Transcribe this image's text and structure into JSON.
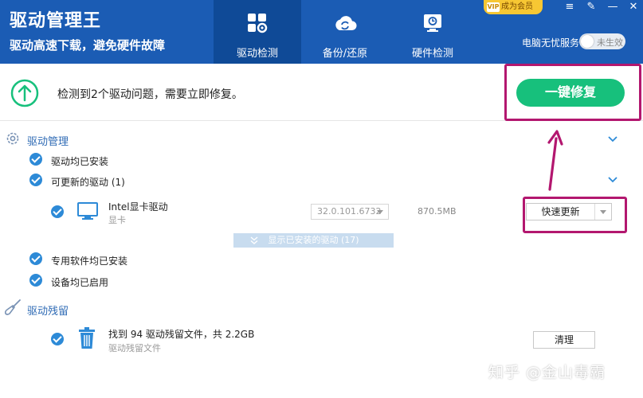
{
  "app": {
    "title": "驱动管理王",
    "subtitle": "驱动高速下载，避免硬件故障"
  },
  "nav": {
    "tabs": [
      {
        "label": "驱动检测",
        "active": true,
        "icon": "grid-gear-icon"
      },
      {
        "label": "备份/还原",
        "active": false,
        "icon": "cloud-sync-icon"
      },
      {
        "label": "硬件检测",
        "active": false,
        "icon": "monitor-check-icon"
      }
    ]
  },
  "vip": {
    "mark": "VIP",
    "label": "成为会员"
  },
  "window_controls": {
    "menu": "≡",
    "skin": "✎",
    "minimize": "—",
    "close": "✕"
  },
  "service": {
    "label": "电脑无忧服务",
    "state": "未生效"
  },
  "alert": {
    "message": "检测到2个驱动问题，需要立即修复。",
    "fix_button": "一键修复"
  },
  "driver_management": {
    "title": "驱动管理",
    "installed": "驱动均已安装",
    "updatable": "可更新的驱动 (1)",
    "driver": {
      "name": "Intel显卡驱动",
      "category": "显卡",
      "version": "32.0.101.6732",
      "size": "870.5MB",
      "action": "快速更新"
    },
    "show_installed": "显示已安装的驱动 (17)",
    "software_installed": "专用软件均已安装",
    "devices_enabled": "设备均已启用"
  },
  "driver_residue": {
    "title": "驱动残留",
    "found": "找到 94 驱动残留文件，共 2.2GB",
    "sub": "驱动残留文件",
    "clean_button": "清理"
  },
  "watermark": "知乎 @金山毒霸",
  "colors": {
    "header_bg": "#1b5cb4",
    "active_tab_bg": "#0f4a97",
    "fix_button": "#17c07c",
    "check": "#2d8ad7",
    "annotation": "#b3176f",
    "vip": "#f7c733"
  }
}
